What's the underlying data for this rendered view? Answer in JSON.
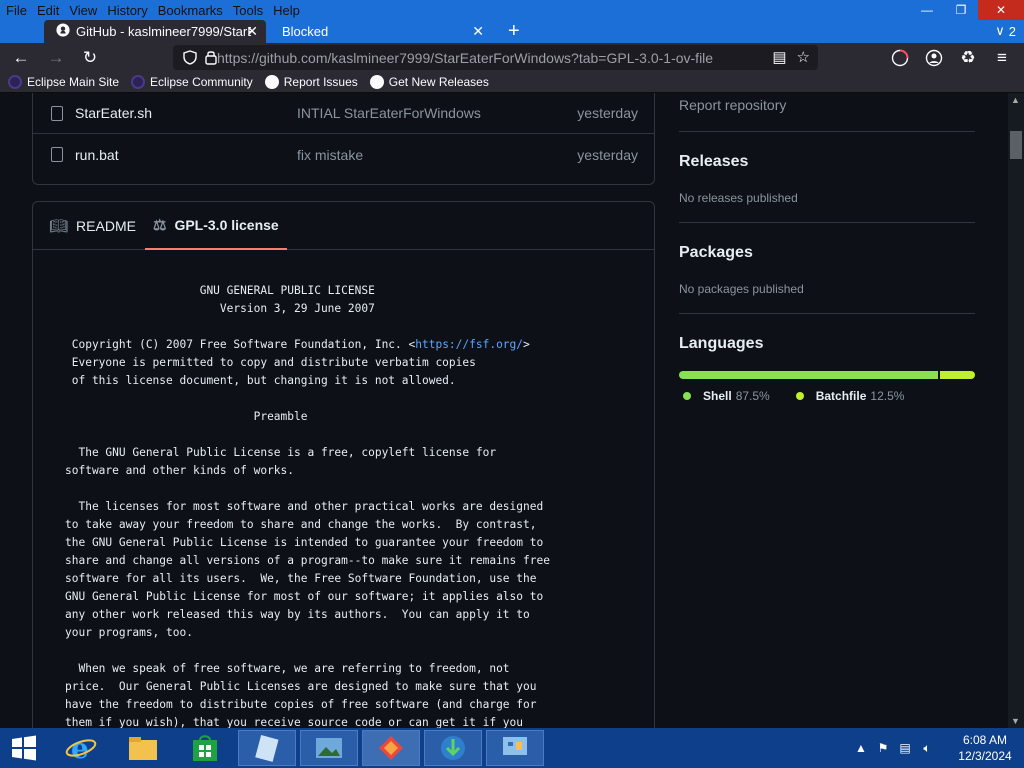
{
  "browser": {
    "menu": [
      "File",
      "Edit",
      "View",
      "History",
      "Bookmarks",
      "Tools",
      "Help"
    ],
    "tabs": [
      {
        "title": "GitHub - kaslmineer7999/StarEa"
      },
      {
        "title": "Blocked"
      }
    ],
    "tab_count": "2",
    "url_host": "https://github.com/",
    "url_path": "kaslmineer7999/StarEaterForWindows?tab=GPL-3.0-1-ov-file",
    "bookmarks": [
      "Eclipse Main Site",
      "Eclipse Community",
      "Report Issues",
      "Get New Releases"
    ]
  },
  "files": [
    {
      "name": "StarEater.sh",
      "message": "INTIAL StarEaterForWindows",
      "date": "yesterday"
    },
    {
      "name": "run.bat",
      "message": "fix mistake",
      "date": "yesterday"
    }
  ],
  "readme_tabs": {
    "readme": "README",
    "license": "GPL-3.0 license"
  },
  "license": {
    "l1": "                    GNU GENERAL PUBLIC LICENSE",
    "l2": "                       Version 3, 29 June 2007",
    "l4a": " Copyright (C) 2007 Free Software Foundation, Inc. <",
    "l4link": "https://fsf.org/",
    "l4b": ">",
    "l5": " Everyone is permitted to copy and distribute verbatim copies",
    "l6": " of this license document, but changing it is not allowed.",
    "l8": "                            Preamble",
    "l10": "  The GNU General Public License is a free, copyleft license for",
    "l11": "software and other kinds of works.",
    "l13": "  The licenses for most software and other practical works are designed",
    "l14": "to take away your freedom to share and change the works.  By contrast,",
    "l15": "the GNU General Public License is intended to guarantee your freedom to",
    "l16": "share and change all versions of a program--to make sure it remains free",
    "l17": "software for all its users.  We, the Free Software Foundation, use the",
    "l18": "GNU General Public License for most of our software; it applies also to",
    "l19": "any other work released this way by its authors.  You can apply it to",
    "l20": "your programs, too.",
    "l22": "  When we speak of free software, we are referring to freedom, not",
    "l23": "price.  Our General Public Licenses are designed to make sure that you",
    "l24": "have the freedom to distribute copies of free software (and charge for",
    "l25": "them if you wish), that you receive source code or can get it if you"
  },
  "sidebar": {
    "report": "Report repository",
    "releases_title": "Releases",
    "releases_sub": "No releases published",
    "packages_title": "Packages",
    "packages_sub": "No packages published",
    "languages_title": "Languages",
    "languages": [
      {
        "name": "Shell",
        "percent": "87.5%",
        "fraction": 0.875,
        "color": "#89e051"
      },
      {
        "name": "Batchfile",
        "percent": "12.5%",
        "fraction": 0.125,
        "color": "#c1f12e"
      }
    ]
  },
  "taskbar": {
    "time": "6:08 AM",
    "date": "12/3/2024"
  }
}
